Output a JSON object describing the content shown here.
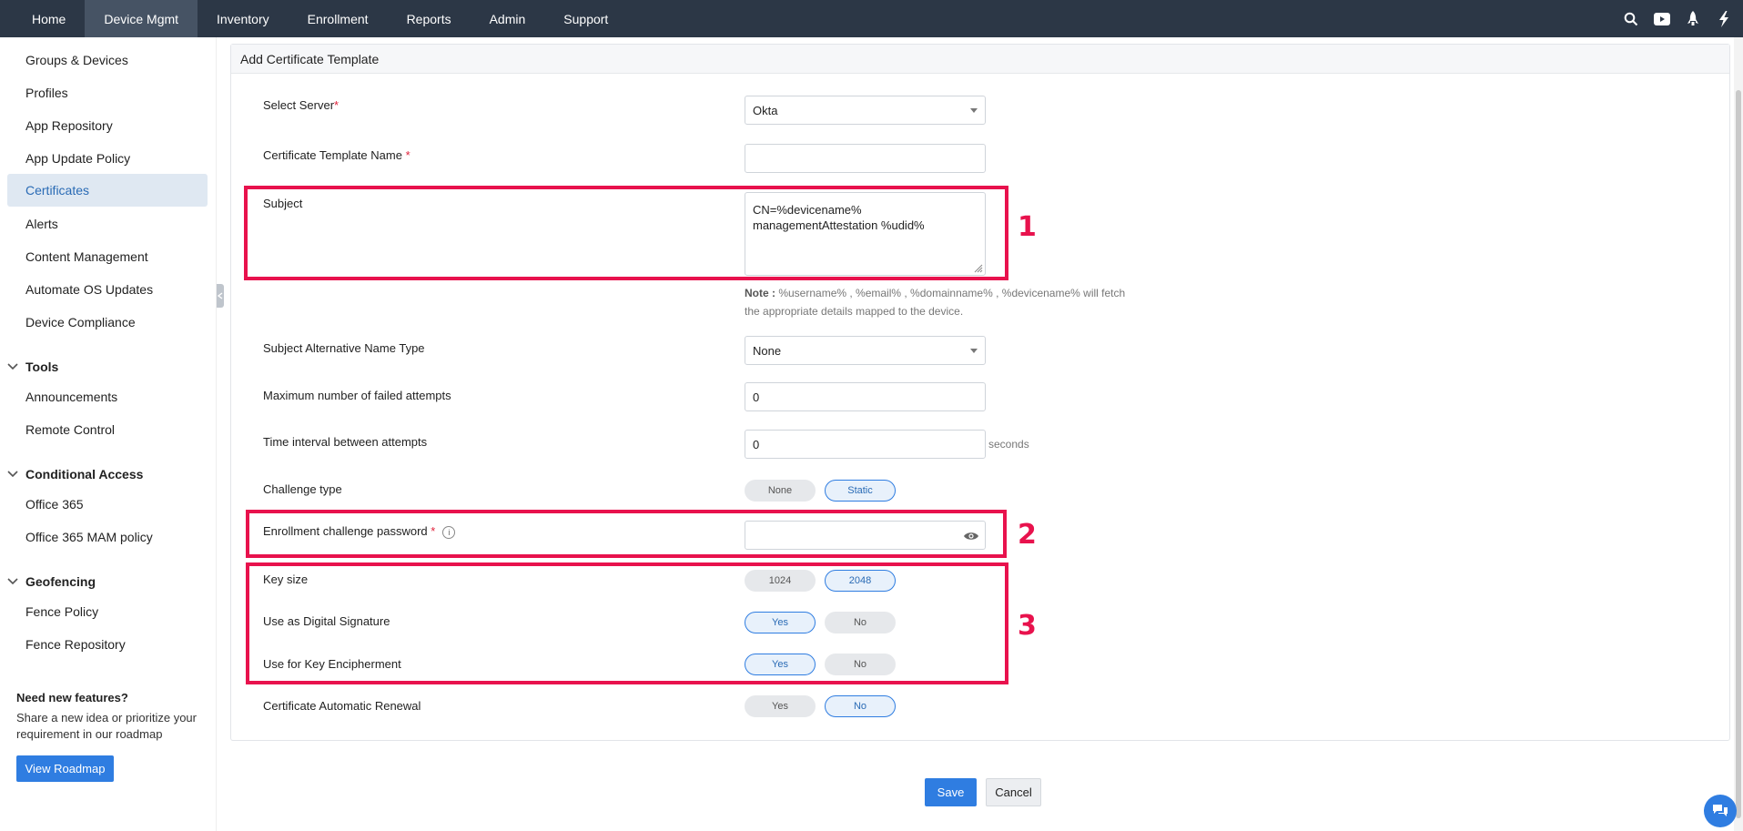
{
  "nav": {
    "tabs": [
      "Home",
      "Device Mgmt",
      "Inventory",
      "Enrollment",
      "Reports",
      "Admin",
      "Support"
    ],
    "active_tab": "Device Mgmt",
    "icons": [
      "search-icon",
      "youtube-icon",
      "rocket-icon",
      "lightning-icon"
    ]
  },
  "sidebar": {
    "items": [
      "Groups & Devices",
      "Profiles",
      "App Repository",
      "App Update Policy",
      "Certificates",
      "Alerts",
      "Content Management",
      "Automate OS Updates",
      "Device Compliance"
    ],
    "active_item": "Certificates",
    "tools": {
      "title": "Tools",
      "items": [
        "Announcements",
        "Remote Control"
      ]
    },
    "conditional_access": {
      "title": "Conditional Access",
      "items": [
        "Office 365",
        "Office 365 MAM policy"
      ]
    },
    "geofencing": {
      "title": "Geofencing",
      "items": [
        "Fence Policy",
        "Fence Repository"
      ]
    },
    "promo": {
      "title": "Need new features?",
      "text": "Share a new idea or prioritize your requirement in our roadmap",
      "button": "View Roadmap"
    }
  },
  "panel": {
    "title": "Add Certificate Template"
  },
  "form": {
    "select_server": {
      "label": "Select Server",
      "value": "Okta"
    },
    "template_name": {
      "label": "Certificate Template Name",
      "value": ""
    },
    "subject": {
      "label": "Subject",
      "value": "CN=%devicename% managementAttestation %udid%"
    },
    "note": {
      "prefix": "Note :",
      "text": " %username% , %email% , %domainname% , %devicename% will fetch the appropriate details mapped to the device."
    },
    "san_type": {
      "label": "Subject Alternative Name Type",
      "value": "None"
    },
    "max_failed": {
      "label": "Maximum number of failed attempts",
      "value": "0"
    },
    "time_interval": {
      "label": "Time interval between attempts",
      "value": "0",
      "suffix": "seconds"
    },
    "challenge_type": {
      "label": "Challenge type",
      "options": [
        "None",
        "Static"
      ],
      "selected": "Static"
    },
    "enrollment_password": {
      "label": "Enrollment challenge password",
      "value": ""
    },
    "key_size": {
      "label": "Key size",
      "options": [
        "1024",
        "2048"
      ],
      "selected": "2048"
    },
    "digital_signature": {
      "label": "Use as Digital Signature",
      "options": [
        "Yes",
        "No"
      ],
      "selected": "Yes"
    },
    "key_encipherment": {
      "label": "Use for Key Encipherment",
      "options": [
        "Yes",
        "No"
      ],
      "selected": "Yes"
    },
    "auto_renewal": {
      "label": "Certificate Automatic Renewal",
      "options": [
        "Yes",
        "No"
      ],
      "selected": "No"
    }
  },
  "annotations": [
    "1",
    "2",
    "3"
  ],
  "actions": {
    "save": "Save",
    "cancel": "Cancel"
  },
  "colors": {
    "nav_bg": "#2c3746",
    "accent": "#2f7de1",
    "highlight": "#e8124d",
    "required": "#e0223b"
  }
}
